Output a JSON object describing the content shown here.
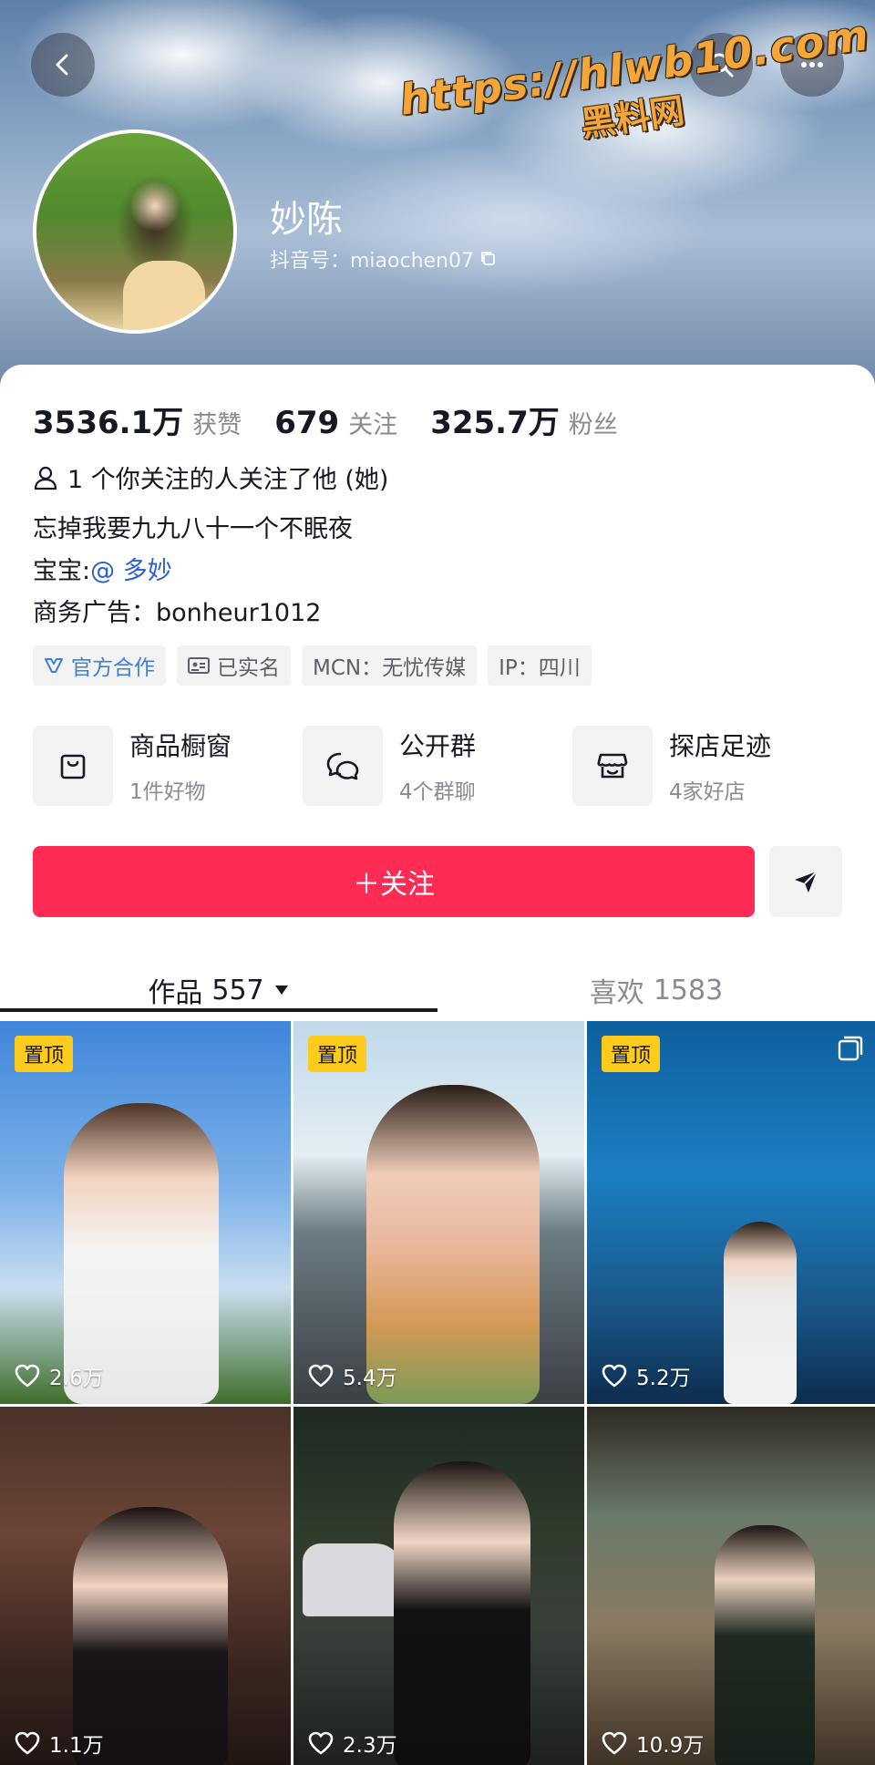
{
  "watermark": {
    "url": "https://hlwb10.com",
    "name": "黑料网"
  },
  "profile": {
    "name": "妙陈",
    "id_text": "抖音号：miaochen07"
  },
  "stats": [
    {
      "value": "3536.1万",
      "label": "获赞"
    },
    {
      "value": "679",
      "label": "关注"
    },
    {
      "value": "325.7万",
      "label": "粉丝"
    }
  ],
  "mutual": "1 个你关注的人关注了他 (她)",
  "bio": {
    "line1": "忘掉我要九九八十一个不眠夜",
    "line2_prefix": "宝宝:",
    "line2_mention": "@ 多妙",
    "line3": "商务广告：bonheur1012"
  },
  "tags": [
    {
      "label": "官方合作",
      "icon": "official-cooperation-icon"
    },
    {
      "label": "已实名",
      "icon": "id-card-icon"
    },
    {
      "label": "MCN：无忧传媒"
    },
    {
      "label": "IP：四川"
    }
  ],
  "features": [
    {
      "title": "商品橱窗",
      "sub": "1件好物",
      "icon": "shopping-bag-icon"
    },
    {
      "title": "公开群",
      "sub": "4个群聊",
      "icon": "chat-group-icon"
    },
    {
      "title": "探店足迹",
      "sub": "4家好店",
      "icon": "store-icon"
    }
  ],
  "follow_label": "＋关注",
  "tabs": {
    "works_label": "作品",
    "works_count": "557",
    "likes_label": "喜欢",
    "likes_count": "1583"
  },
  "videos": [
    {
      "pinned": "置顶",
      "likes": "2.6万"
    },
    {
      "pinned": "置顶",
      "likes": "5.4万"
    },
    {
      "pinned": "置顶",
      "likes": "5.2万"
    },
    {
      "likes": "1.1万"
    },
    {
      "likes": "2.3万"
    },
    {
      "likes": "10.9万"
    }
  ],
  "colors": {
    "accent": "#fe2c55",
    "pin_badge": "#fdcb1c",
    "mention": "#2b5fc9",
    "official_tag": "#3f7fd8"
  }
}
